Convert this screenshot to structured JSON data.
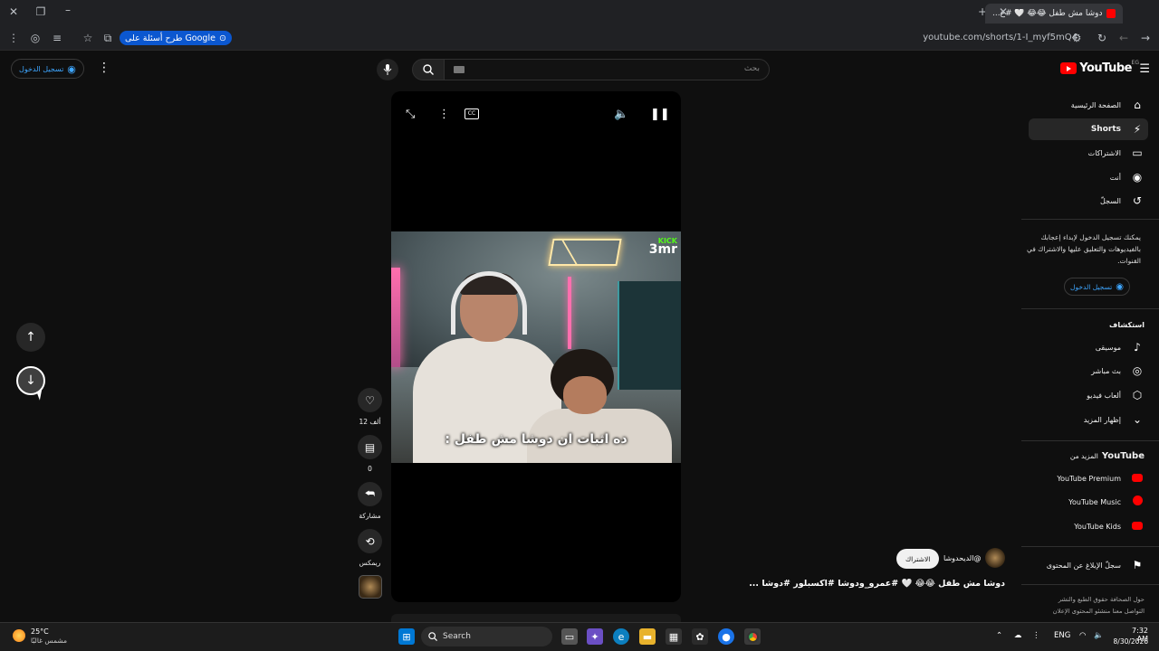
{
  "browser": {
    "tab_title": "دوشا مش طفل 😂😂 🤍 #ع...",
    "url": "youtube.com/shorts/1-I_myf5mQ4",
    "ask_google_label": "طرح أسئلة على Google"
  },
  "header": {
    "search_placeholder": "بحث",
    "sign_in_label": "تسجيل الدخول",
    "logo_text": "YouTube",
    "logo_region": "EG"
  },
  "sidebar": {
    "items": [
      {
        "label": "الصفحة الرئيسية",
        "icon": "home-icon"
      },
      {
        "label": "Shorts",
        "icon": "shorts-icon",
        "active": true
      },
      {
        "label": "الاشتراكات",
        "icon": "subscriptions-icon"
      },
      {
        "label": "أنت",
        "icon": "you-icon"
      },
      {
        "label": "السجلّ",
        "icon": "history-icon"
      }
    ],
    "signin_note": "يمكنك تسجيل الدخول لإبداء إعجابك بالفيديوهات والتعليق عليها والاشتراك في القنوات.",
    "signin_label": "تسجيل الدخول",
    "explore_heading": "استكشاف",
    "explore_items": [
      {
        "label": "موسيقى",
        "icon": "music-icon"
      },
      {
        "label": "بث مباشر",
        "icon": "live-icon"
      },
      {
        "label": "ألعاب فيديو",
        "icon": "gaming-icon"
      },
      {
        "label": "إظهار المزيد",
        "icon": "chevron-down-icon"
      }
    ],
    "more_heading_prefix": "المزيد من",
    "more_heading_brand": "YouTube",
    "more_items": [
      {
        "label": "YouTube Premium"
      },
      {
        "label": "YouTube Music"
      },
      {
        "label": "YouTube Kids"
      }
    ],
    "report_label": "سجلّ الإبلاغ عن المحتوى",
    "footer_line1": "حول  الصحافة  حقوق الطبع والنشر",
    "footer_line2": "التواصل معنا  منشئو المحتوى  الإعلان"
  },
  "video": {
    "subtitle": "ده اثبات ان دوشا مش طفل :",
    "overlay_kick": "KICK",
    "overlay_brand": "3mr",
    "title": "دوشا مش طفل 😂😂 🤍 #عمرو_ودوشا #اكسبلور #دوشا ...",
    "channel_name": "@الديحدوشا",
    "subscribe_label": "الاشتراك"
  },
  "actions": {
    "likes_label": "12 ألف",
    "comments_label": "0",
    "share_label": "مشاركة",
    "remix_label": "ريمكس"
  },
  "taskbar": {
    "weather_temp": "25°C",
    "weather_desc": "مشمس غالبًا",
    "search_label": "Search",
    "lang": "ENG",
    "time": "7:32 AM",
    "date": "8/30/2026"
  }
}
